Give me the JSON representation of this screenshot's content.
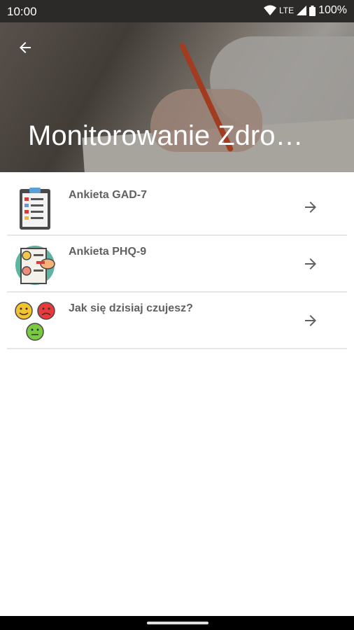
{
  "status_bar": {
    "time": "10:00",
    "network": "LTE",
    "battery": "100%"
  },
  "header": {
    "title": "Monitorowanie Zdro…"
  },
  "items": [
    {
      "label": "Ankieta GAD-7",
      "icon": "clipboard-checklist-icon"
    },
    {
      "label": "Ankieta PHQ-9",
      "icon": "mood-checklist-icon"
    },
    {
      "label": "Jak się dzisiaj czujesz?",
      "icon": "mood-faces-icon"
    }
  ],
  "colors": {
    "status_bg": "#2c2a28",
    "label": "#616161",
    "divider": "#e6e6e6"
  }
}
